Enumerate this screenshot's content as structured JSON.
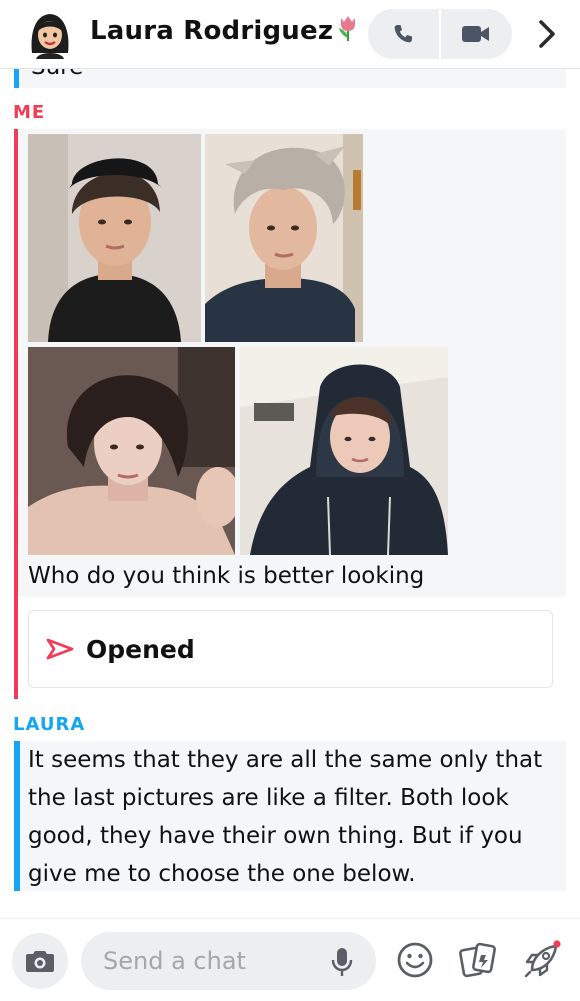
{
  "header": {
    "contact_name": "Laura Rodriguez",
    "call_icon": "phone-icon",
    "video_icon": "video-camera-icon",
    "more_icon": "chevron-right-icon"
  },
  "conversation": {
    "previous_message_fragment": "Sure",
    "my_message": {
      "sender": "ME",
      "text": "Who do you think is better looking",
      "status": "Opened"
    },
    "reply": {
      "sender": "LAURA",
      "text": "It seems that they are all the same only that the last pictures are like a filter. Both look good, they have their own thing. But if you give me to choose the one below."
    }
  },
  "composer": {
    "placeholder": "Send a chat"
  },
  "colors": {
    "me_accent": "#f23c57",
    "friend_accent": "#13a6f2",
    "bubble_bg": "#f5f6f8"
  }
}
